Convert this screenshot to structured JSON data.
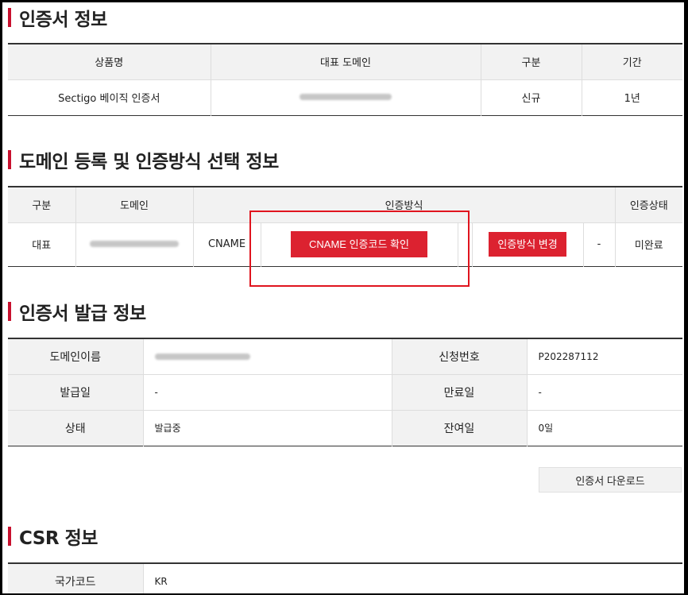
{
  "sections": {
    "cert_info": "인증서 정보",
    "domain_reg": "도메인 등록 및 인증방식 선택 정보",
    "issuance": "인증서 발급 정보",
    "csr": "CSR 정보"
  },
  "cert_table": {
    "headers": [
      "상품명",
      "대표 도메인",
      "구분",
      "기간"
    ],
    "row": {
      "product": "Sectigo 베이직 인증서",
      "type": "신규",
      "period": "1년"
    }
  },
  "domain_table": {
    "headers": [
      "구분",
      "도메인",
      "인증방식",
      "인증상태"
    ],
    "row": {
      "kind": "대표",
      "method": "CNAME",
      "check_button": "CNAME 인증코드 확인",
      "change_button": "인증방식 변경",
      "dash": "-",
      "status": "미완료"
    }
  },
  "issuance_table": {
    "domain_label": "도메인이름",
    "request_no_label": "신청번호",
    "request_no": "P202287112",
    "issue_date_label": "발급일",
    "issue_date": "-",
    "expire_label": "만료일",
    "expire": "-",
    "status_label": "상태",
    "status": "발급중",
    "remaining_label": "잔여일",
    "remaining": "0일"
  },
  "download_button": "인증서 다운로드",
  "csr_table": {
    "country_label": "국가코드",
    "country": "KR"
  },
  "colors": {
    "accent": "#c8102e",
    "button_red": "#dc2230",
    "highlight": "#e0141e"
  }
}
